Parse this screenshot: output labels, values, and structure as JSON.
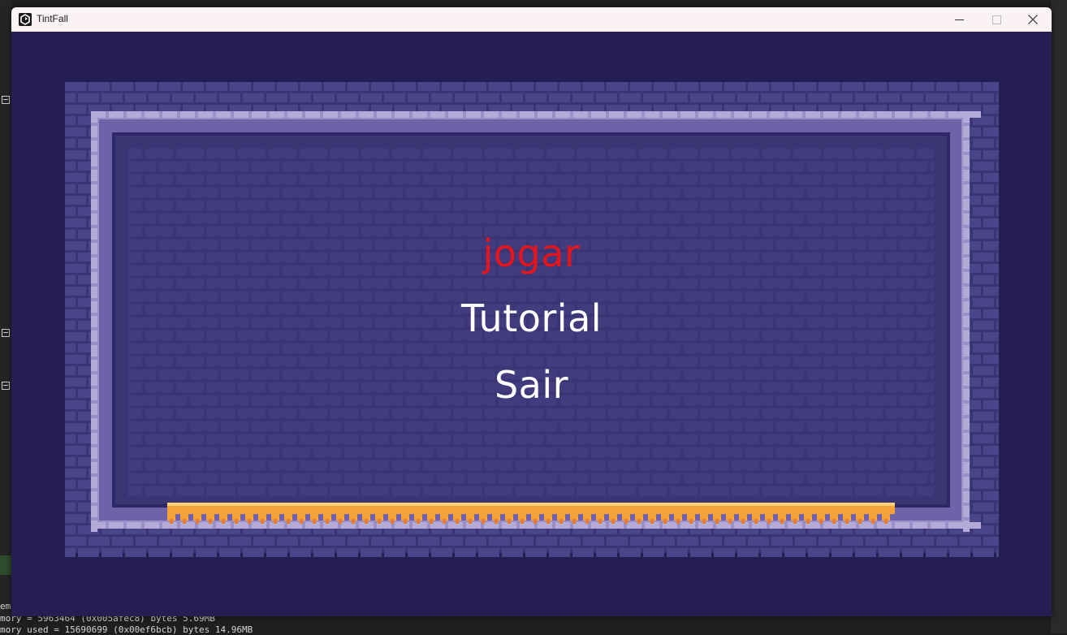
{
  "window": {
    "title": "TintFall",
    "minimize_icon": "minimize-icon",
    "maximize_icon": "maximize-icon",
    "close_icon": "close-icon"
  },
  "menu": {
    "items": [
      {
        "label": "jogar",
        "color": "#e8141c",
        "selected": true
      },
      {
        "label": "Tutorial",
        "color": "#ffffff",
        "selected": false
      },
      {
        "label": "Sair",
        "color": "#ffffff",
        "selected": false
      }
    ]
  },
  "colors": {
    "background": "#241e52",
    "wall_inner": "#3b3573",
    "border_light": "#9a8fc6",
    "lava": "#f6a23a"
  },
  "console": {
    "line1": "mory = 5963464 (0x005afec8) bytes 5.69MB",
    "line2": "mory used = 15690699 (0x00ef6bcb) bytes 14.96MB",
    "label": "emo"
  }
}
